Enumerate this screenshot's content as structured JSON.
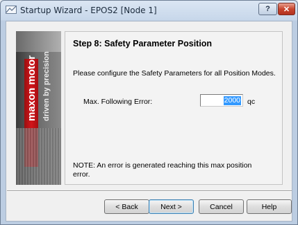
{
  "window": {
    "title": "Startup Wizard - EPOS2 [Node 1]",
    "help_caption": "?",
    "close_caption": "✕"
  },
  "banner": {
    "brand": "maxon motor",
    "tagline": "driven by precision"
  },
  "step": {
    "title": "Step 8: Safety Parameter Position",
    "instruction": "Please configure the Safety Parameters for all Position Modes.",
    "field": {
      "label": "Max. Following Error:",
      "value": "2000",
      "unit": "qc"
    },
    "note": "NOTE: An error is generated reaching this max position error."
  },
  "buttons": {
    "back": "< Back",
    "next": "Next >",
    "cancel": "Cancel",
    "help": "Help"
  }
}
